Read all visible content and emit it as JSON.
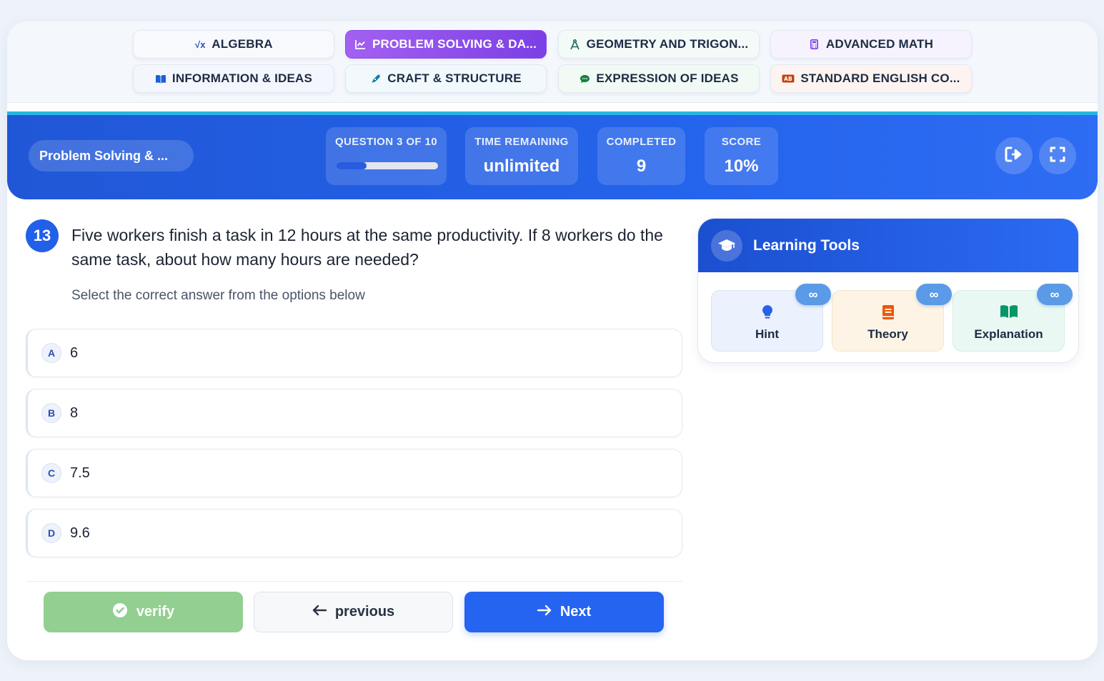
{
  "categories": [
    {
      "label": "ALGEBRA",
      "icon": "sqrt-icon",
      "glyph": "√x",
      "color": "#2a4fb3",
      "active": false
    },
    {
      "label": "PROBLEM SOLVING & DA...",
      "icon": "chart-line-icon",
      "glyph": "📈",
      "color": "#ffffff",
      "active": true
    },
    {
      "label": "GEOMETRY AND TRIGON...",
      "icon": "compass-icon",
      "glyph": "✎",
      "color": "#1b6b5e",
      "active": false
    },
    {
      "label": "ADVANCED MATH",
      "icon": "calculator-icon",
      "glyph": "▦",
      "color": "#7c3aed",
      "active": false
    },
    {
      "label": "INFORMATION & IDEAS",
      "icon": "book-open-icon",
      "glyph": "▮▮",
      "color": "#1d5fd6",
      "active": false
    },
    {
      "label": "CRAFT & STRUCTURE",
      "icon": "pen-nib-icon",
      "glyph": "✒",
      "color": "#0e7ea6",
      "active": false
    },
    {
      "label": "EXPRESSION OF IDEAS",
      "icon": "comment-icon",
      "glyph": "●",
      "color": "#15803d",
      "active": false
    },
    {
      "label": "STANDARD ENGLISH CO...",
      "icon": "spell-check-icon",
      "glyph": "AB",
      "color": "#c2410c",
      "active": false
    }
  ],
  "header": {
    "topic": "Problem Solving & ...",
    "question_label": "QUESTION 3 OF 10",
    "progress": 0.3,
    "time_label": "TIME REMAINING",
    "time_value": "unlimited",
    "completed_label": "COMPLETED",
    "completed_value": "9",
    "score_label": "SCORE",
    "score_value": "10%"
  },
  "question": {
    "number": "13",
    "text": "Five workers finish a task in 12 hours at the same productivity. If 8 workers do the same task, about how many hours are needed?",
    "instruction": "Select the correct answer from the options below",
    "options": [
      {
        "letter": "A",
        "text": "6"
      },
      {
        "letter": "B",
        "text": "8"
      },
      {
        "letter": "C",
        "text": "7.5"
      },
      {
        "letter": "D",
        "text": "9.6"
      }
    ]
  },
  "buttons": {
    "verify": "verify",
    "previous": "previous",
    "next": "Next"
  },
  "tools": {
    "title": "Learning Tools",
    "badge": "∞",
    "items": [
      {
        "label": "Hint",
        "icon": "lightbulb-icon",
        "color": "#2563eb"
      },
      {
        "label": "Theory",
        "icon": "book-icon",
        "color": "#ea580c"
      },
      {
        "label": "Explanation",
        "icon": "book-open-icon",
        "color": "#059669"
      }
    ]
  }
}
